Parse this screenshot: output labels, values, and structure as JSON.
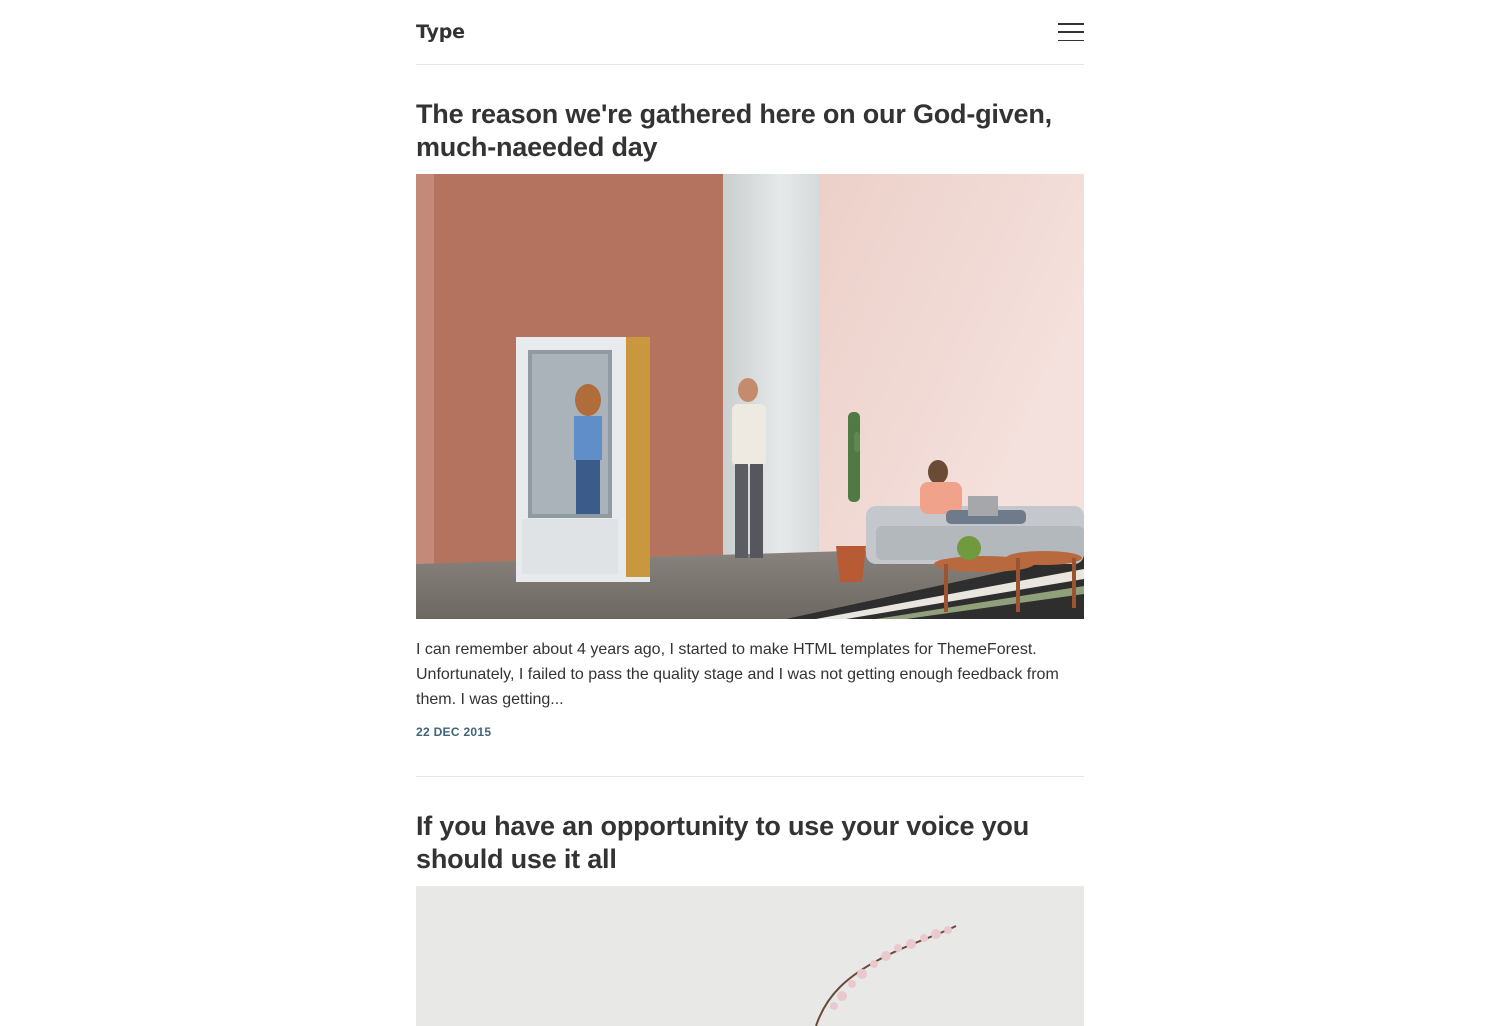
{
  "site": {
    "logo": "Type"
  },
  "posts": [
    {
      "title": "The reason we're gathered here on our God-given, much-naeeded day",
      "excerpt": "I can remember about 4 years ago, I started to make HTML templates for ThemeForest. Unfortunately, I failed to pass the quality stage and I was not getting enough feedback from them. I was getting...",
      "date": "22 DEC 2015",
      "image": "office-phone-booth-photo"
    },
    {
      "title": "If you have an opportunity to use your voice you should use it all",
      "image": "cherry-blossom-branch-photo"
    }
  ],
  "colors": {
    "text": "#333333",
    "date": "#3e6477",
    "divider": "#e6e6e6"
  }
}
